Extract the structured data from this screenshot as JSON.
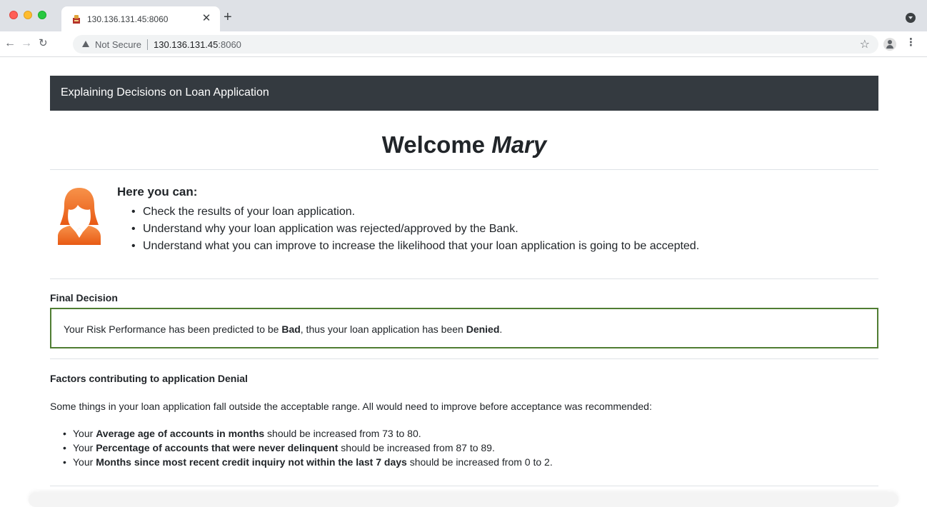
{
  "browser": {
    "tab_title": "130.136.131.45:8060",
    "security_label": "Not Secure",
    "url_host": "130.136.131.45",
    "url_port": ":8060"
  },
  "app": {
    "brand": "Explaining Decisions on Loan Application",
    "welcome_prefix": "Welcome ",
    "user_name": "Mary"
  },
  "intro": {
    "title": "Here you can:",
    "items": [
      "Check the results of your loan application.",
      "Understand why your loan application was rejected/approved by the Bank.",
      "Understand what you can improve to increase the likelihood that your loan application is going to be accepted."
    ]
  },
  "decision": {
    "title": "Final Decision",
    "text_before": "Your Risk Performance has been predicted to be ",
    "risk": "Bad",
    "text_middle": ", thus your loan application has been ",
    "outcome": "Denied",
    "text_after": ".",
    "border_color": "#4f7d32"
  },
  "factors": {
    "title": "Factors contributing to application Denial",
    "intro": "Some things in your loan application fall outside the acceptable range. All would need to improve before acceptance was recommended:",
    "items": [
      {
        "prefix": "Your ",
        "feature": "Average age of accounts in months",
        "text": " should be increased from 73 to 80."
      },
      {
        "prefix": "Your ",
        "feature": "Percentage of accounts that were never delinquent",
        "text": " should be increased from 87 to 89."
      },
      {
        "prefix": "Your ",
        "feature": "Months since most recent credit inquiry not within the last 7 days",
        "text": " should be increased from 0 to 2."
      }
    ]
  },
  "colors": {
    "navbar": "#343a40",
    "avatar": "#f26722"
  }
}
